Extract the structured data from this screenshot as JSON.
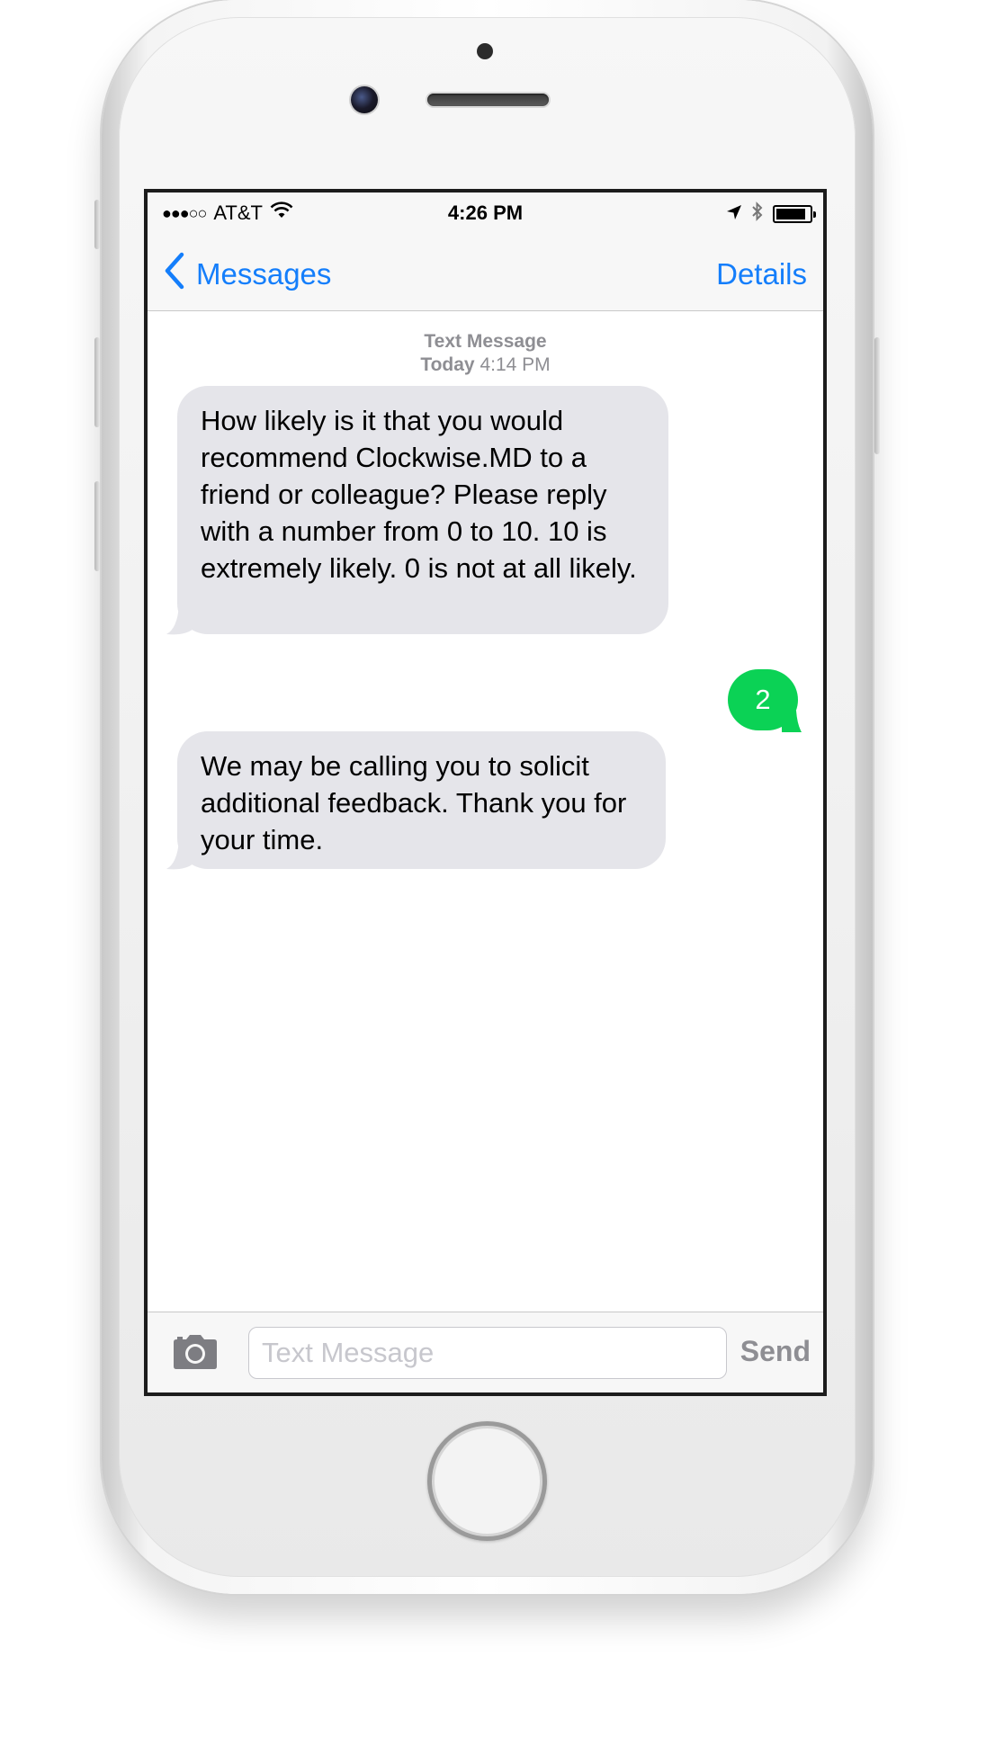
{
  "status_bar": {
    "signal": "●●●○○",
    "carrier": "AT&T",
    "wifi_icon": "wifi-icon",
    "time": "4:26 PM",
    "location_icon": "location-arrow-icon",
    "bluetooth_icon": "bluetooth-icon",
    "battery_icon": "battery-icon"
  },
  "nav": {
    "back_label": "Messages",
    "details_label": "Details"
  },
  "thread": {
    "header_title": "Text Message",
    "header_day": "Today",
    "header_time": "4:14 PM"
  },
  "messages": [
    {
      "direction": "incoming",
      "text": "How likely is it that you would recommend Clockwise.MD to a friend or colleague? Please reply with a number from 0 to 10. 10 is extremely likely. 0 is not at all likely."
    },
    {
      "direction": "outgoing",
      "text": "2"
    },
    {
      "direction": "incoming",
      "text": "We may be calling you to solicit additional feedback. Thank you for your time."
    }
  ],
  "input_bar": {
    "placeholder": "Text Message",
    "send_label": "Send"
  },
  "colors": {
    "ios_blue": "#147efb",
    "incoming_bubble": "#e5e5ea",
    "outgoing_bubble": "#0bd255",
    "meta_gray": "#8e8e93"
  }
}
